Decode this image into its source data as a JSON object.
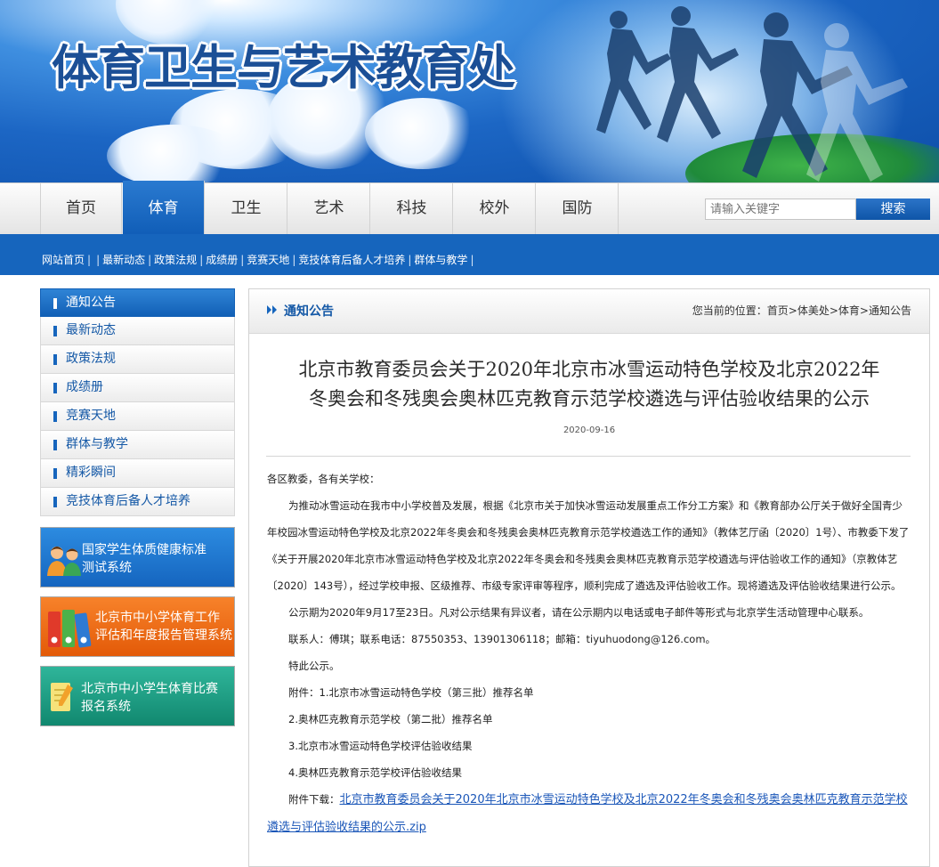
{
  "site": {
    "title": "体育卫生与艺术教育处"
  },
  "nav": {
    "items": [
      "首页",
      "体育",
      "卫生",
      "艺术",
      "科技",
      "校外",
      "国防"
    ],
    "active_index": 1,
    "search_placeholder": "请输入关键字",
    "search_button": "搜索"
  },
  "subnav": {
    "items": [
      "网站首页",
      "最新动态",
      "政策法规",
      "成绩册",
      "竞赛天地",
      "竞技体育后备人才培养",
      "群体与教学"
    ]
  },
  "sidebar": {
    "items": [
      {
        "label": "通知公告"
      },
      {
        "label": "最新动态"
      },
      {
        "label": "政策法规"
      },
      {
        "label": "成绩册"
      },
      {
        "label": "竞赛天地"
      },
      {
        "label": "群体与教学"
      },
      {
        "label": "精彩瞬间"
      },
      {
        "label": "竞技体育后备人才培养"
      }
    ],
    "active_index": 0,
    "promos": [
      {
        "line1": "国家学生体质健康标准",
        "line2": "测试系统",
        "color": "#1a6ec8"
      },
      {
        "line1": "北京市中小学体育工作",
        "line2": "评估和年度报告管理系统",
        "color": "#ec6a12"
      },
      {
        "line1": "北京市中小学生体育比赛",
        "line2": "报名系统",
        "color": "#1a9c80"
      }
    ]
  },
  "content": {
    "section": "通知公告",
    "breadcrumb_prefix": "您当前的位置：",
    "breadcrumb": [
      "首页",
      "体美处",
      "体育",
      "通知公告"
    ],
    "article": {
      "title_line1": "北京市教育委员会关于2020年北京市冰雪运动特色学校及北京2022年",
      "title_line2": "冬奥会和冬残奥会奥林匹克教育示范学校遴选与评估验收结果的公示",
      "date": "2020-09-16",
      "salutation": "各区教委，各有关学校：",
      "para1": "为推动冰雪运动在我市中小学校普及发展，根据《北京市关于加快冰雪运动发展重点工作分工方案》和《教育部办公厅关于做好全国青少年校园冰雪运动特色学校及北京2022年冬奥会和冬残奥会奥林匹克教育示范学校遴选工作的通知》（教体艺厅函〔2020〕1号）、市教委下发了《关于开展2020年北京市冰雪运动特色学校及北京2022年冬奥会和冬残奥会奥林匹克教育示范学校遴选与评估验收工作的通知》（京教体艺〔2020〕143号），经过学校申报、区级推荐、市级专家评审等程序，顺利完成了遴选及评估验收工作。现将遴选及评估验收结果进行公示。",
      "para2": "公示期为2020年9月17至23日。凡对公示结果有异议者，请在公示期内以电话或电子邮件等形式与北京学生活动管理中心联系。",
      "contact": "联系人：傅琪；联系电话：87550353、13901306118；邮箱：tiyuhuodong@126.com。",
      "closing": "特此公示。",
      "attachment1": "附件：1.北京市冰雪运动特色学校（第三批）推荐名单",
      "attachment2": "2.奥林匹克教育示范学校（第二批）推荐名单",
      "attachment3": "3.北京市冰雪运动特色学校评估验收结果",
      "attachment4": "4.奥林匹克教育示范学校评估验收结果",
      "download_label": "附件下载：",
      "download_link": "北京市教育委员会关于2020年北京市冰雪运动特色学校及北京2022年冬奥会和冬残奥会奥林匹克教育示范学校遴选与评估验收结果的公示.zip"
    }
  }
}
